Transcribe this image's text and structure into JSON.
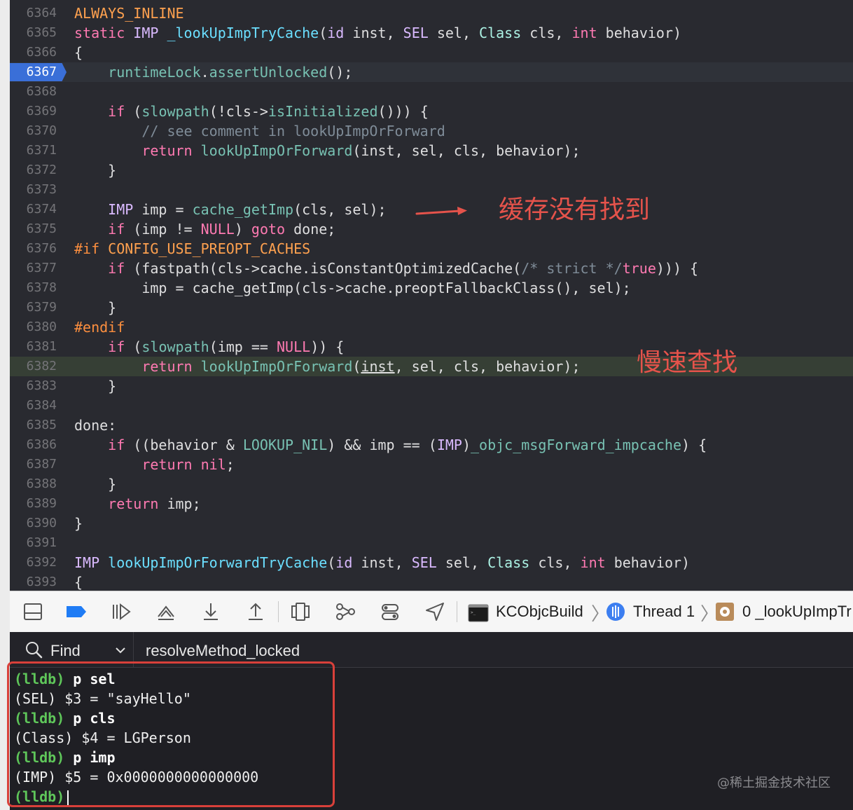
{
  "editor": {
    "lines": [
      {
        "n": "6364",
        "segs": [
          {
            "t": "ALWAYS_INLINE",
            "c": "mc"
          }
        ]
      },
      {
        "n": "6365",
        "segs": [
          {
            "t": "static",
            "c": "kw"
          },
          {
            "t": " "
          },
          {
            "t": "IMP",
            "c": "ty"
          },
          {
            "t": " "
          },
          {
            "t": "_lookUpImpTryCache",
            "c": "fn2"
          },
          {
            "t": "("
          },
          {
            "t": "id",
            "c": "ty"
          },
          {
            "t": " inst, "
          },
          {
            "t": "SEL",
            "c": "ty"
          },
          {
            "t": " sel, "
          },
          {
            "t": "Class",
            "c": "cls"
          },
          {
            "t": " cls, "
          },
          {
            "t": "int",
            "c": "kw"
          },
          {
            "t": " behavior)"
          }
        ]
      },
      {
        "n": "6366",
        "segs": [
          {
            "t": "{"
          }
        ]
      },
      {
        "n": "6367",
        "current": true,
        "segs": [
          {
            "t": "    "
          },
          {
            "t": "runtimeLock",
            "c": "fn"
          },
          {
            "t": "."
          },
          {
            "t": "assertUnlocked",
            "c": "fn"
          },
          {
            "t": "();"
          }
        ]
      },
      {
        "n": "6368",
        "segs": []
      },
      {
        "n": "6369",
        "segs": [
          {
            "t": "    "
          },
          {
            "t": "if",
            "c": "kw"
          },
          {
            "t": " ("
          },
          {
            "t": "slowpath",
            "c": "fn"
          },
          {
            "t": "(!cls->"
          },
          {
            "t": "isInitialized",
            "c": "fn"
          },
          {
            "t": "())) {"
          }
        ]
      },
      {
        "n": "6370",
        "segs": [
          {
            "t": "        "
          },
          {
            "t": "// see comment in lookUpImpOrForward",
            "c": "cm"
          }
        ]
      },
      {
        "n": "6371",
        "segs": [
          {
            "t": "        "
          },
          {
            "t": "return",
            "c": "kw"
          },
          {
            "t": " "
          },
          {
            "t": "lookUpImpOrForward",
            "c": "fn"
          },
          {
            "t": "(inst, sel, cls, behavior);"
          }
        ]
      },
      {
        "n": "6372",
        "segs": [
          {
            "t": "    }"
          }
        ]
      },
      {
        "n": "6373",
        "segs": []
      },
      {
        "n": "6374",
        "segs": [
          {
            "t": "    "
          },
          {
            "t": "IMP",
            "c": "ty"
          },
          {
            "t": " imp = "
          },
          {
            "t": "cache_getImp",
            "c": "fn"
          },
          {
            "t": "(cls, sel);"
          }
        ]
      },
      {
        "n": "6375",
        "segs": [
          {
            "t": "    "
          },
          {
            "t": "if",
            "c": "kw"
          },
          {
            "t": " (imp != "
          },
          {
            "t": "NULL",
            "c": "kw"
          },
          {
            "t": ") "
          },
          {
            "t": "goto",
            "c": "kw"
          },
          {
            "t": " done;"
          }
        ]
      },
      {
        "n": "6376",
        "segs": [
          {
            "t": "#if ",
            "c": "pp"
          },
          {
            "t": "CONFIG_USE_PREOPT_CACHES",
            "c": "mc"
          }
        ]
      },
      {
        "n": "6377",
        "segs": [
          {
            "t": "    "
          },
          {
            "t": "if",
            "c": "kw"
          },
          {
            "t": " (fastpath(cls->cache.isConstantOptimizedCache("
          },
          {
            "t": "/* strict */",
            "c": "cm"
          },
          {
            "t": "true",
            "c": "kw"
          },
          {
            "t": "))) {"
          }
        ]
      },
      {
        "n": "6378",
        "segs": [
          {
            "t": "        imp = cache_getImp(cls->cache.preoptFallbackClass(), sel);"
          }
        ]
      },
      {
        "n": "6379",
        "segs": [
          {
            "t": "    }"
          }
        ]
      },
      {
        "n": "6380",
        "segs": [
          {
            "t": "#endif",
            "c": "pp"
          }
        ]
      },
      {
        "n": "6381",
        "segs": [
          {
            "t": "    "
          },
          {
            "t": "if",
            "c": "kw"
          },
          {
            "t": " ("
          },
          {
            "t": "slowpath",
            "c": "fn"
          },
          {
            "t": "(imp == "
          },
          {
            "t": "NULL",
            "c": "kw"
          },
          {
            "t": ")) {"
          }
        ]
      },
      {
        "n": "6382",
        "stop": true,
        "segs": [
          {
            "t": "        "
          },
          {
            "t": "return",
            "c": "kw"
          },
          {
            "t": " "
          },
          {
            "t": "lookUpImpOrForward",
            "c": "fn"
          },
          {
            "t": "("
          },
          {
            "t": "inst",
            "c": "u"
          },
          {
            "t": ", sel, cls, behavior);"
          }
        ]
      },
      {
        "n": "6383",
        "segs": [
          {
            "t": "    }"
          }
        ]
      },
      {
        "n": "6384",
        "segs": []
      },
      {
        "n": "6385",
        "segs": [
          {
            "t": "done:"
          }
        ]
      },
      {
        "n": "6386",
        "segs": [
          {
            "t": "    "
          },
          {
            "t": "if",
            "c": "kw"
          },
          {
            "t": " ((behavior & "
          },
          {
            "t": "LOOKUP_NIL",
            "c": "fn"
          },
          {
            "t": ") && imp == ("
          },
          {
            "t": "IMP",
            "c": "ty"
          },
          {
            "t": ")"
          },
          {
            "t": "_objc_msgForward_impcache",
            "c": "fn"
          },
          {
            "t": ") {"
          }
        ]
      },
      {
        "n": "6387",
        "segs": [
          {
            "t": "        "
          },
          {
            "t": "return",
            "c": "kw"
          },
          {
            "t": " "
          },
          {
            "t": "nil",
            "c": "kw"
          },
          {
            "t": ";"
          }
        ]
      },
      {
        "n": "6388",
        "segs": [
          {
            "t": "    }"
          }
        ]
      },
      {
        "n": "6389",
        "segs": [
          {
            "t": "    "
          },
          {
            "t": "return",
            "c": "kw"
          },
          {
            "t": " imp;"
          }
        ]
      },
      {
        "n": "6390",
        "segs": [
          {
            "t": "}"
          }
        ]
      },
      {
        "n": "6391",
        "segs": []
      },
      {
        "n": "6392",
        "segs": [
          {
            "t": "IMP",
            "c": "ty"
          },
          {
            "t": " "
          },
          {
            "t": "lookUpImpOrForwardTryCache",
            "c": "fn2"
          },
          {
            "t": "("
          },
          {
            "t": "id",
            "c": "ty"
          },
          {
            "t": " inst, "
          },
          {
            "t": "SEL",
            "c": "ty"
          },
          {
            "t": " sel, "
          },
          {
            "t": "Class",
            "c": "cls"
          },
          {
            "t": " cls, "
          },
          {
            "t": "int",
            "c": "kw"
          },
          {
            "t": " behavior)"
          }
        ]
      },
      {
        "n": "6393",
        "segs": [
          {
            "t": "{"
          }
        ]
      }
    ]
  },
  "annotations": {
    "cache_miss": "缓存没有找到",
    "slow_lookup": "慢速查找"
  },
  "toolbar": {
    "target": "KCObjcBuild",
    "thread": "Thread 1",
    "frame": "0 _lookUpImpTr"
  },
  "console": {
    "find_label": "Find",
    "find_value": "resolveMethod_locked",
    "prompt": "(lldb)",
    "cmd1": "p sel",
    "out1": "(SEL) $3 = \"sayHello\"",
    "cmd2": "p cls",
    "out2": "(Class) $4 = LGPerson",
    "cmd3": "p imp",
    "out3": "(IMP) $5 = 0x0000000000000000"
  },
  "watermark": "@稀土掘金技术社区",
  "colors": {
    "annotation": "#e5534b",
    "prompt": "#5fc75a",
    "current_line_marker": "#3a6fd8"
  }
}
